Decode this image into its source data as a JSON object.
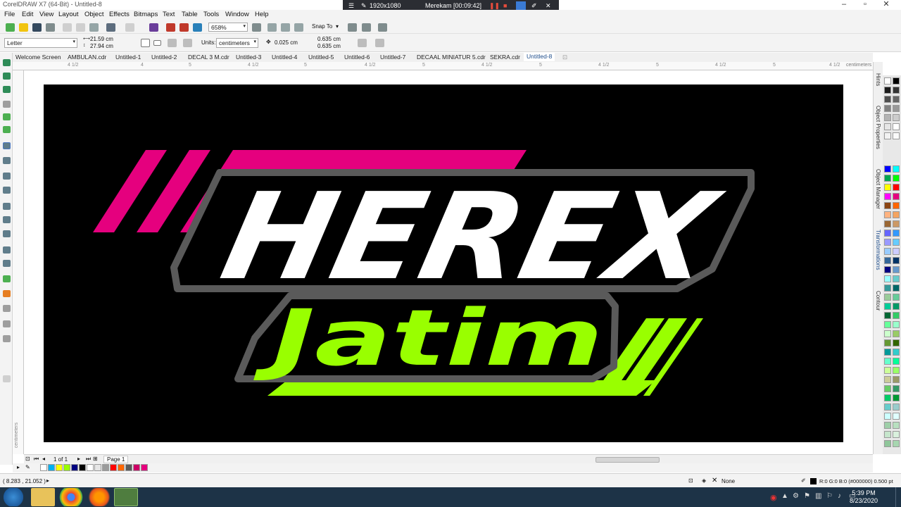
{
  "window": {
    "title": "CorelDRAW X7 (64-Bit) - Untitled-8"
  },
  "recorder": {
    "resolution": "1920x1080",
    "status": "Merekam [00:09:42]"
  },
  "menu": [
    "File",
    "Edit",
    "View",
    "Layout",
    "Object",
    "Effects",
    "Bitmaps",
    "Text",
    "Table",
    "Tools",
    "Window",
    "Help"
  ],
  "toolbar": {
    "zoom": "658%",
    "snap_label": "Snap To"
  },
  "property_bar": {
    "page_size": "Letter",
    "width": "21.59 cm",
    "height": "27.94 cm",
    "units_label": "Units:",
    "units_value": "centimeters",
    "nudge": "0.025 cm",
    "dup_x": "0.635 cm",
    "dup_y": "0.635 cm"
  },
  "tabs": [
    "Welcome Screen",
    "AMBULAN.cdr",
    "Untitled-1",
    "Untitled-2",
    "DECAL 3 M.cdr",
    "Untitled-3",
    "Untitled-4",
    "Untitled-5",
    "Untitled-6",
    "Untitled-7",
    "DECAAL MINIATUR 5.cdr",
    "SEKRA.cdr",
    "Untitled-8"
  ],
  "ruler": {
    "h_labels": [
      "4 1/2",
      "4",
      "5",
      "4 1/2",
      "5",
      "4 1/2",
      "5",
      "4 1/2",
      "5",
      "4 1/2",
      "5",
      "4 1/2",
      "5",
      "4 1/2"
    ],
    "unit": "centimeters",
    "v_unit": "centimeters"
  },
  "artwork": {
    "line1": "HEREX",
    "line2": "Jatim"
  },
  "dockers": [
    "Hints",
    "Object Properties",
    "Object Manager",
    "Transformations",
    "Contour"
  ],
  "page_nav": {
    "counter": "1 of 1",
    "page_tab": "Page 1"
  },
  "status": {
    "coords": "( 8.283 , 21.052 )",
    "fill_label": "None",
    "outline_info": "R:0 G:0 B:0 (#000000)  0.500 pt"
  },
  "clock": {
    "time": "5:39 PM",
    "date": "8/23/2020"
  },
  "colors": {
    "magenta": "#e5007e",
    "lime": "#99ff00",
    "white": "#ffffff",
    "gray": "#9b9b9b",
    "outline_gray": "#5a5a5a"
  }
}
